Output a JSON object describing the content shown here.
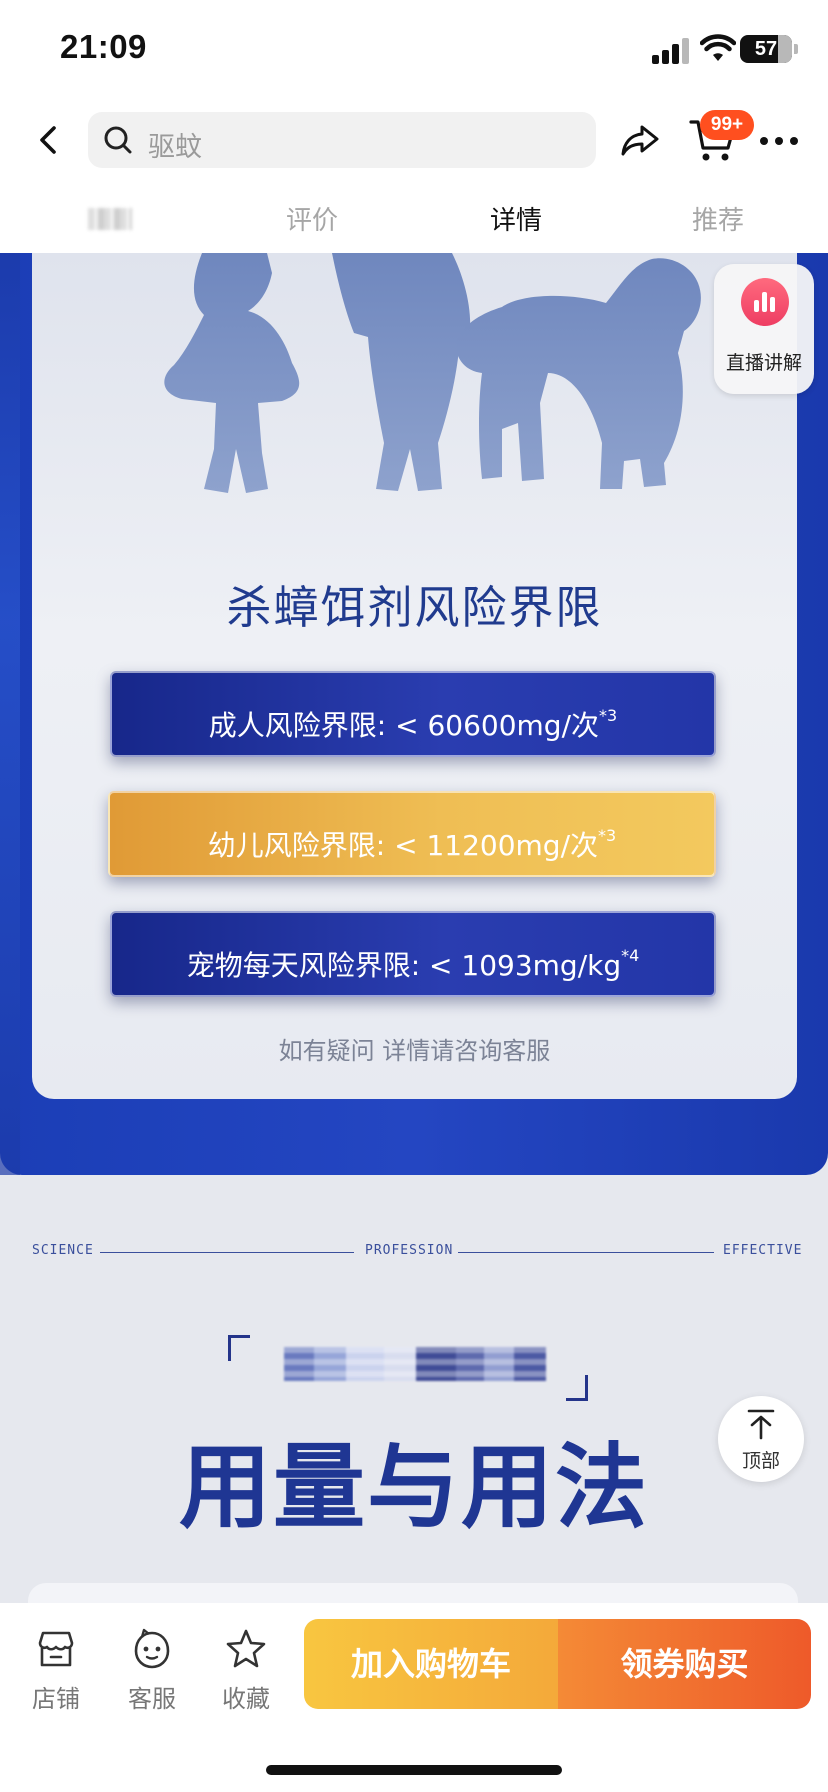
{
  "status_bar": {
    "time": "21:09",
    "battery": "57",
    "icons": [
      "signal-icon",
      "wifi-icon",
      "battery-icon"
    ]
  },
  "nav": {
    "search_placeholder": "驱蚊",
    "cart_badge": "99+",
    "icons": [
      "back-icon",
      "search-icon",
      "share-icon",
      "cart-icon",
      "more-icon"
    ]
  },
  "tabs": [
    {
      "label": "评价"
    },
    {
      "label": "详情"
    },
    {
      "label": "推荐"
    }
  ],
  "active_tab": "详情",
  "floating": {
    "live_label": "直播讲解",
    "top_label": "顶部"
  },
  "content": {
    "risk_title": "杀蟑饵剂风险界限",
    "risk_items": [
      {
        "text": "成人风险界限: < 60600mg/次",
        "note": "*3",
        "style": "blue"
      },
      {
        "text": "幼儿风险界限: < 11200mg/次",
        "note": "*3",
        "style": "gold"
      },
      {
        "text": "宠物每天风险界限: < 1093mg/kg",
        "note": "*4",
        "style": "blue"
      }
    ],
    "consult": "如有疑问 详情请咨询客服",
    "tagline": {
      "left": "SCIENCE",
      "middle": "PROFESSION",
      "right": "EFFECTIVE"
    },
    "usage_title": "用量与用法"
  },
  "bottom_bar": {
    "store": "店铺",
    "service": "客服",
    "favorite": "收藏",
    "add_to_cart": "加入购物车",
    "buy_with_coupon": "领券购买"
  },
  "colors": {
    "brand_orange": "#ee5a2a",
    "cta_yellow": "#f8c640",
    "panel_blue": "#2446c2",
    "title_navy": "#1f3693",
    "badge_red": "#ff4f1f",
    "live_pink": "#ee3d63"
  }
}
